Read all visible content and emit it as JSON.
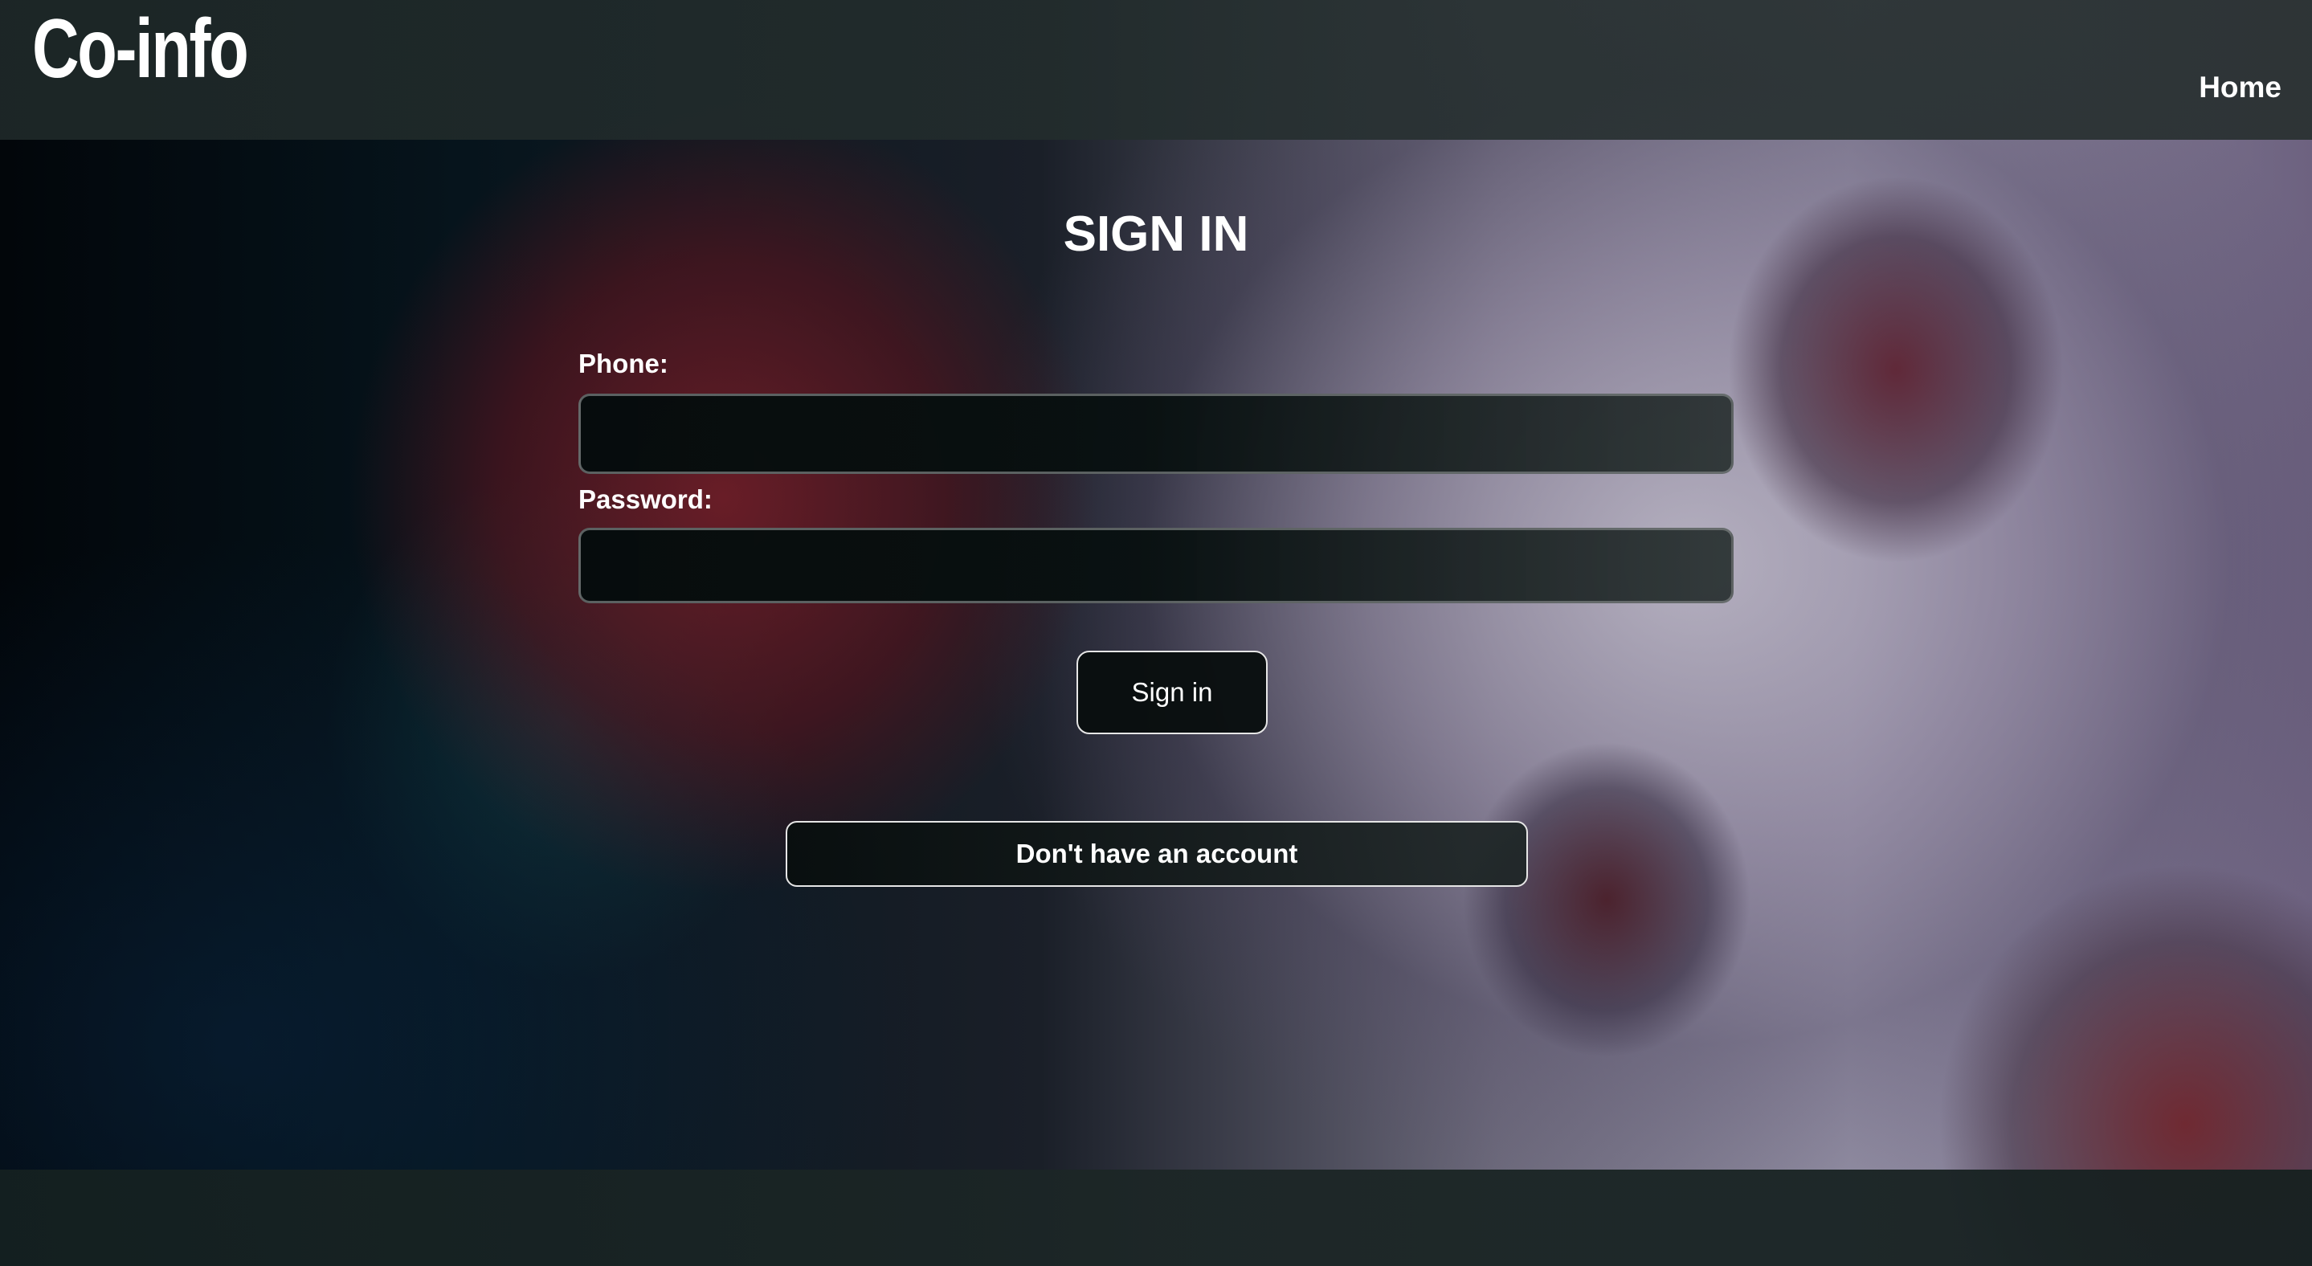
{
  "header": {
    "logo": "Co-info",
    "nav_home": "Home"
  },
  "form": {
    "title": "SIGN IN",
    "phone_label": "Phone:",
    "phone_value": "",
    "password_label": "Password:",
    "password_value": "",
    "signin_button": "Sign in",
    "no_account_button": "Don't have an account"
  }
}
